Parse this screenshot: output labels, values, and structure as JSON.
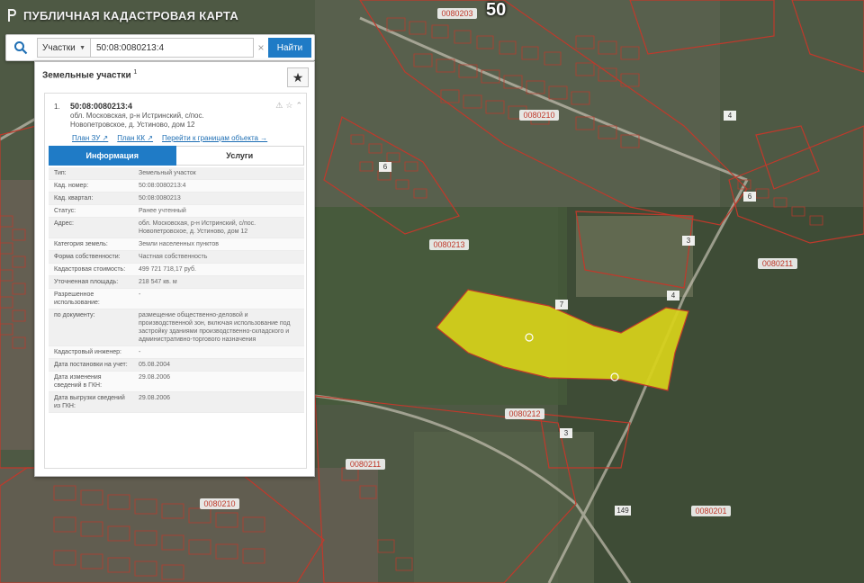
{
  "header": {
    "title": "ПУБЛИЧНАЯ КАДАСТРОВАЯ КАРТА",
    "region_label": "50"
  },
  "search": {
    "type_selected": "Участки",
    "query": "50:08:0080213:4",
    "submit_label": "Найти"
  },
  "panel": {
    "title": "Земельные участки",
    "count_superscript": "1",
    "result": {
      "index": "1.",
      "cadastral_number": "50:08:0080213:4",
      "address": "обл. Московская, р-н Истринский, с/пос. Новопетровское, д. Устиново, дом 12",
      "links": {
        "plan_zu": "План ЗУ ↗",
        "plan_kk": "План КК ↗",
        "boundaries": "Перейти к границам объекта →"
      },
      "tabs": {
        "info": "Информация",
        "services": "Услуги"
      },
      "attributes": [
        {
          "key": "Тип:",
          "value": "Земельный участок"
        },
        {
          "key": "Кад. номер:",
          "value": "50:08:0080213:4"
        },
        {
          "key": "Кад. квартал:",
          "value": "50:08:0080213"
        },
        {
          "key": "Статус:",
          "value": "Ранее учтенный"
        },
        {
          "key": "Адрес:",
          "value": "обл. Московская, р-н Истринский, с/пос. Новопетровское, д. Устиново, дом 12"
        },
        {
          "key": "Категория земель:",
          "value": "Земли населенных пунктов"
        },
        {
          "key": "Форма собственности:",
          "value": "Частная собственность"
        },
        {
          "key": "Кадастровая стоимость:",
          "value": "499 721 718,17 руб."
        },
        {
          "key": "Уточненная площадь:",
          "value": "218 547 кв. м"
        },
        {
          "key": "Разрешенное использование:",
          "value": "-"
        },
        {
          "key": "по документу:",
          "value": "размещение общественно-деловой и производственной зон, включая использование под застройку зданиями производственно-складского и административно-торгового назначения"
        },
        {
          "key": "Кадастровый инженер:",
          "value": "-"
        },
        {
          "key": "Дата постановки на учет:",
          "value": "05.08.2004"
        },
        {
          "key": "Дата изменения сведений в ГКН:",
          "value": "29.08.2006"
        },
        {
          "key": "Дата выгрузки сведений из ГКН:",
          "value": "29.08.2006"
        }
      ]
    }
  },
  "map": {
    "quarter_labels": [
      {
        "id": "q1",
        "text": "0080203"
      },
      {
        "id": "q2",
        "text": "0080210"
      },
      {
        "id": "q3",
        "text": "0080213"
      },
      {
        "id": "q4",
        "text": "0080211"
      },
      {
        "id": "q5",
        "text": "0080212"
      },
      {
        "id": "q6",
        "text": "0080201"
      },
      {
        "id": "q7",
        "text": "0080211"
      },
      {
        "id": "q8",
        "text": "0080210"
      }
    ],
    "parcel_numbers": [
      {
        "id": "p1",
        "text": "4"
      },
      {
        "id": "p2",
        "text": "3"
      },
      {
        "id": "p3",
        "text": "6"
      },
      {
        "id": "p4",
        "text": "7"
      },
      {
        "id": "p5",
        "text": "4"
      },
      {
        "id": "p6",
        "text": "3"
      },
      {
        "id": "p7",
        "text": "149"
      },
      {
        "id": "p8",
        "text": "6"
      }
    ],
    "colors": {
      "background": "#4f5a43",
      "parcel_stroke": "#c0392b",
      "selected_fill": "#d8d21a",
      "accent": "#1f7bc6"
    }
  }
}
